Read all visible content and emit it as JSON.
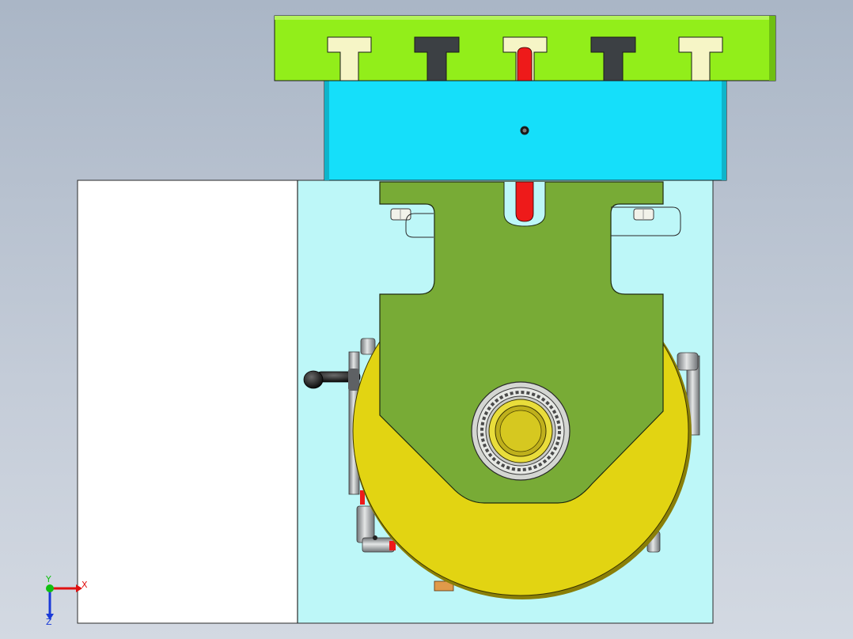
{
  "triad": {
    "x_label": "X",
    "y_label": "Y",
    "z_label": "Z",
    "x_color": "#e01010",
    "y_color": "#10c010",
    "z_color": "#1a3ad8"
  },
  "colors": {
    "top_plate": "#92ee1a",
    "slot_light": "#f6f5c6",
    "slot_dark": "#3c4044",
    "mid_block": "#15dffa",
    "base_cyan": "#bdf7f8",
    "base_white": "#ffffff",
    "bracket_green": "#78ab36",
    "rotary_yellow": "#e2d412",
    "bearing_gray": "#d4d6d2",
    "shaft_yellow": "#bfb01c",
    "pin_red": "#ee1a1a"
  },
  "icons": [
    "coordinate-triad-icon",
    "bolt-head-icon",
    "handle-lever-icon",
    "bearing-icon",
    "pipe-fitting-icon"
  ]
}
